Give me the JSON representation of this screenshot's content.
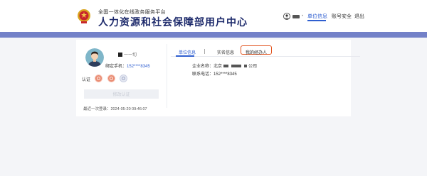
{
  "header": {
    "platform_subtitle": "全国一体化在线政务服务平台",
    "platform_title": "人力资源和社会保障部用户中心",
    "user_dot": "•"
  },
  "nav": {
    "items": [
      {
        "label": "单位信息",
        "active": true
      },
      {
        "label": "账号安全",
        "active": false
      },
      {
        "label": "退出",
        "active": false
      }
    ]
  },
  "profile": {
    "name_suffix": "一一切",
    "phone_label": "绑定手机：",
    "phone_value": "152****8345",
    "auth_label": "认证",
    "action_button": "修改认证",
    "last_login": "最近一次登录：2024-05-20 09:46:07"
  },
  "tabs": [
    {
      "label": "单位信息"
    },
    {
      "label": "实名信息"
    },
    {
      "label": "我的经办人"
    }
  ],
  "company": {
    "name_label": "企业名称：",
    "name_prefix": "北京",
    "name_suffix": "公司",
    "phone_label": "联系电话：",
    "phone_value": "152****8345"
  },
  "colors": {
    "accent": "#2f5fd0",
    "band": "#7381c8",
    "highlight": "#e2541f",
    "badge": "#e98a70"
  }
}
